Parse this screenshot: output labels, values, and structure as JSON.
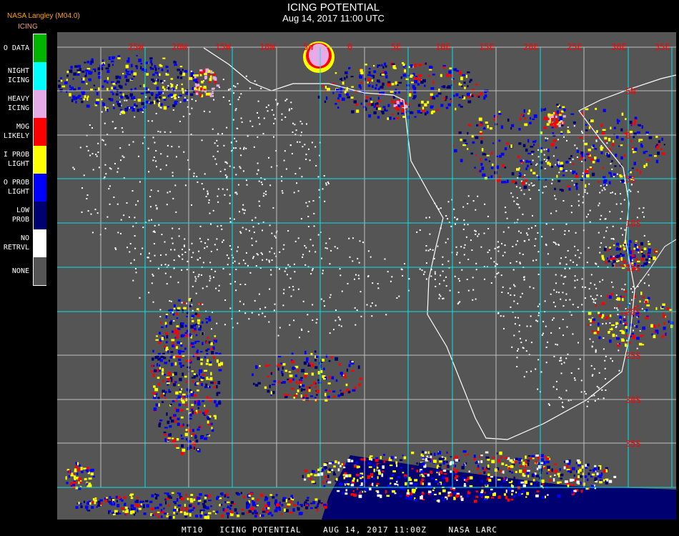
{
  "header": {
    "title": "ICING POTENTIAL",
    "datetime": "Aug 14, 2017 11:00 UTC",
    "source": "NASA Langley (M04.0)",
    "product": "ICING"
  },
  "legend": [
    {
      "label": "O DATA",
      "color": "#00b400"
    },
    {
      "label": "NIGHT\nICING",
      "color": "#00ffff"
    },
    {
      "label": "HEAVY\nICING",
      "color": "#e6aae6"
    },
    {
      "label": "MOG\nLIKELY",
      "color": "#ff0000"
    },
    {
      "label": "I PROB\nLIGHT",
      "color": "#ffff00"
    },
    {
      "label": "O PROB\nLIGHT",
      "color": "#0000ff"
    },
    {
      "label": "LOW\nPROB",
      "color": "#000070"
    },
    {
      "label": "NO\nRETRVL",
      "color": "#ffffff"
    },
    {
      "label": "NONE",
      "color": "#555555"
    }
  ],
  "map": {
    "lon_labels": [
      "25W",
      "20W",
      "15W",
      "10W",
      "5W",
      "0",
      "5E",
      "10E",
      "15E",
      "20E",
      "25E",
      "30E",
      "35E"
    ],
    "lat_labels": [
      "5N",
      "0",
      "5S",
      "10S",
      "15S",
      "20S",
      "25S",
      "30S",
      "35S"
    ],
    "grid_color": "#00e8e8",
    "label_color": "#ff0000",
    "background": "#555555"
  },
  "footer": "MT10   ICING POTENTIAL    AUG 14, 2017 11:00Z    NASA LARC"
}
